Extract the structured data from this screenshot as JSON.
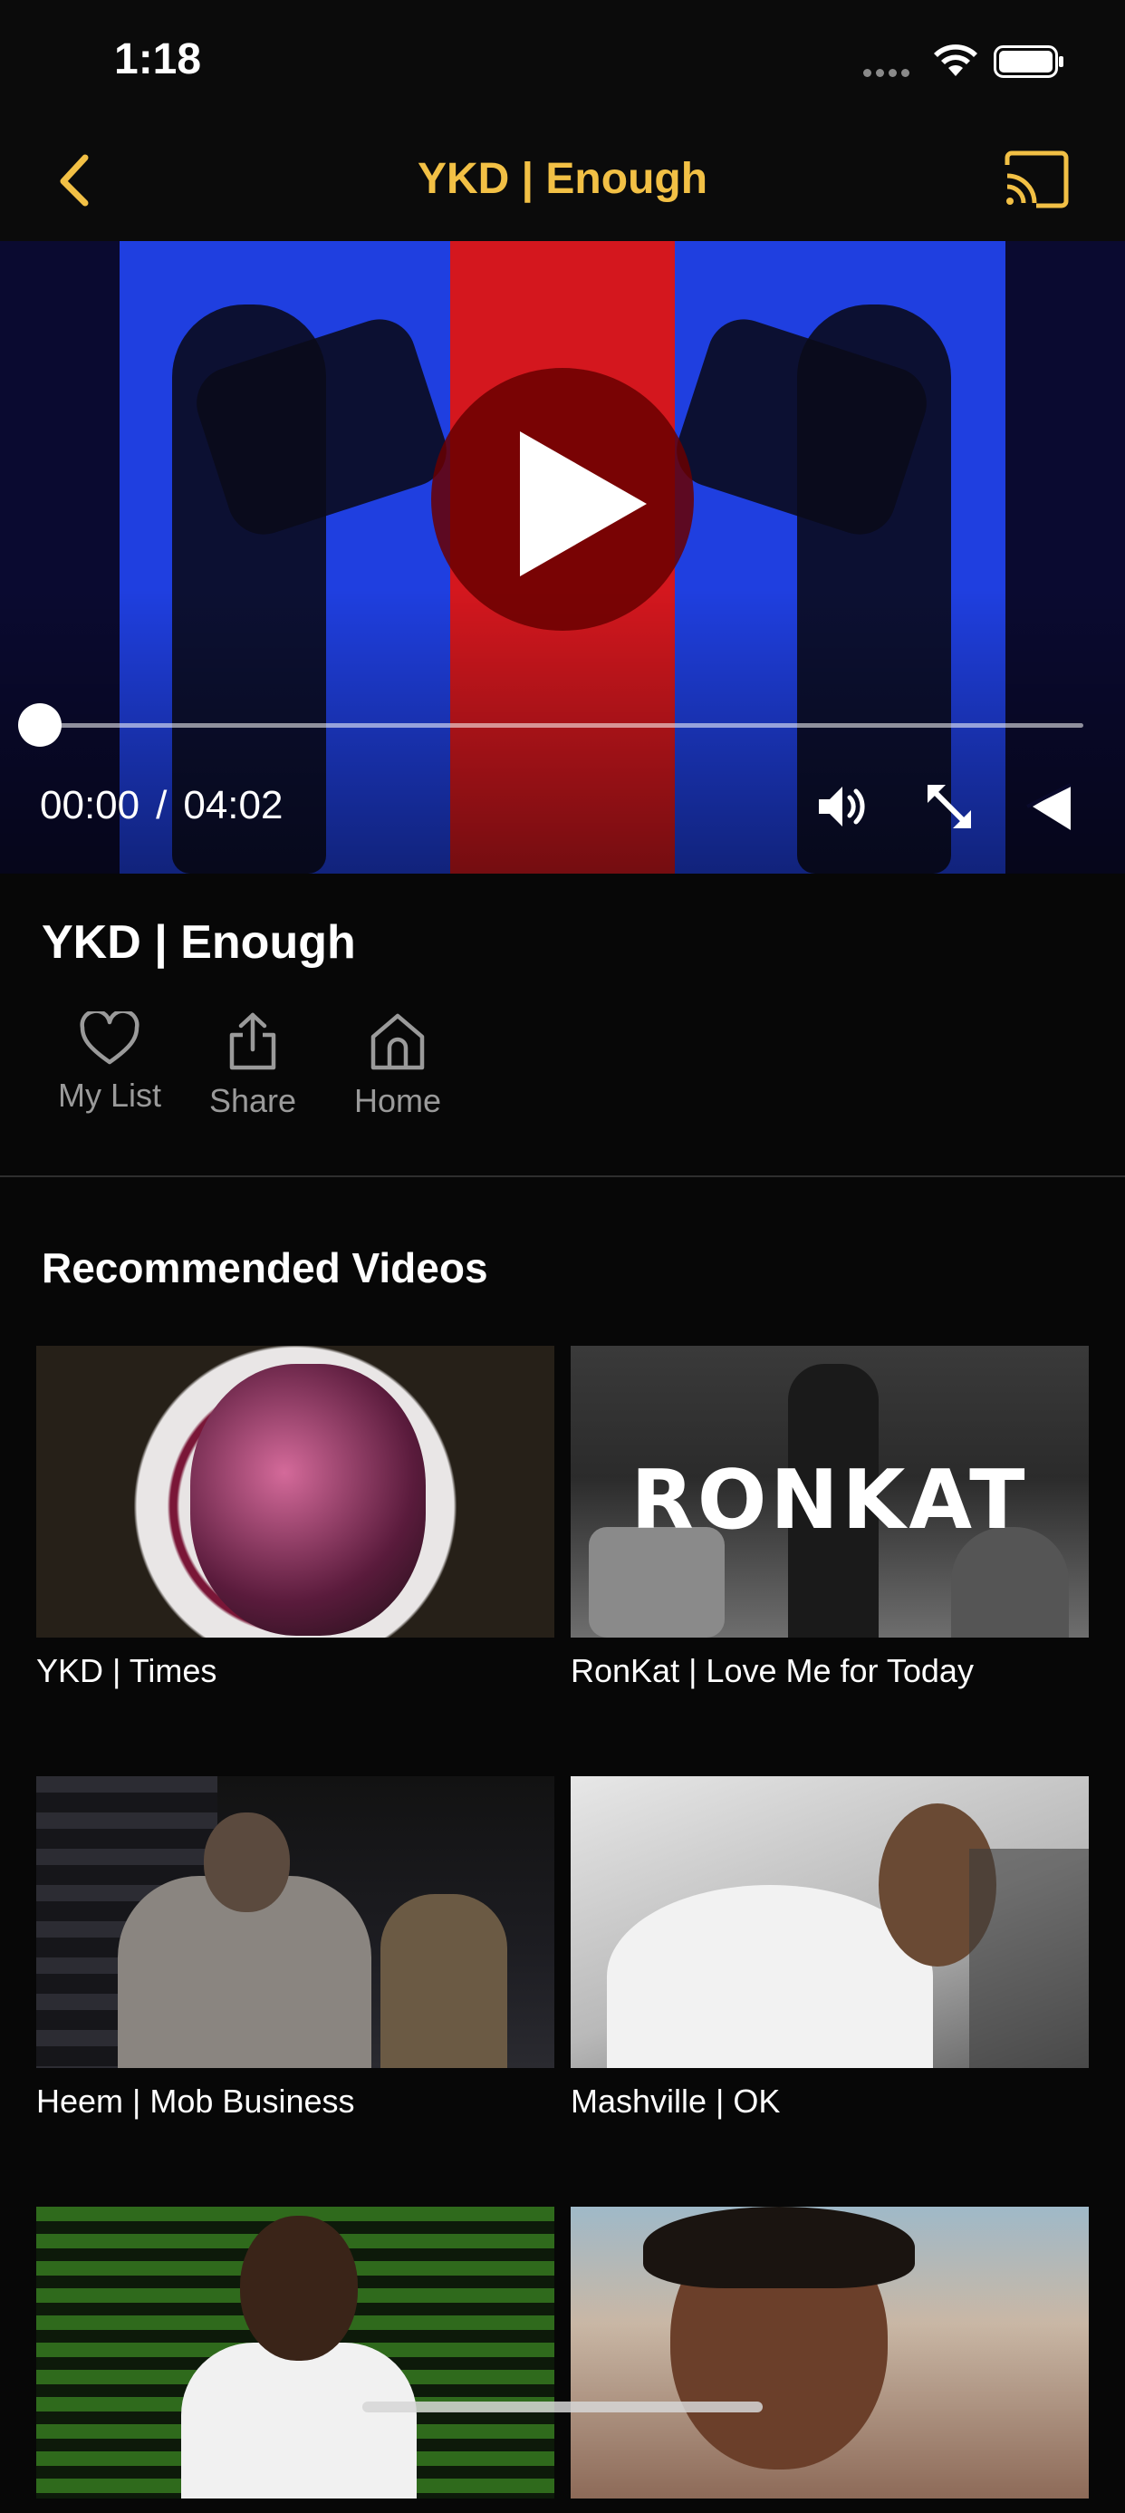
{
  "status_bar": {
    "time": "1:18"
  },
  "nav": {
    "title": "YKD | Enough",
    "back_icon": "chevron-left-icon",
    "cast_icon": "cast-icon",
    "accent": "#f2c045"
  },
  "player": {
    "current_time": "00:00",
    "separator": "/",
    "duration": "04:02",
    "progress": 0,
    "colors": {
      "blue": "#1f3fe0",
      "red": "#d4171e",
      "play_overlay": "#690000"
    }
  },
  "video": {
    "title": "YKD | Enough",
    "actions": [
      {
        "label": "My List",
        "icon": "heart-icon"
      },
      {
        "label": "Share",
        "icon": "share-icon"
      },
      {
        "label": "Home",
        "icon": "home-icon"
      }
    ]
  },
  "recommended": {
    "title": "Recommended Videos",
    "items": [
      {
        "title": "YKD | Times"
      },
      {
        "title": "RonKat | Love Me for Today",
        "thumb_text": "RONKAT"
      },
      {
        "title": "Heem | Mob Business"
      },
      {
        "title": "Mashville | OK"
      },
      {
        "title": ""
      },
      {
        "title": ""
      }
    ]
  }
}
